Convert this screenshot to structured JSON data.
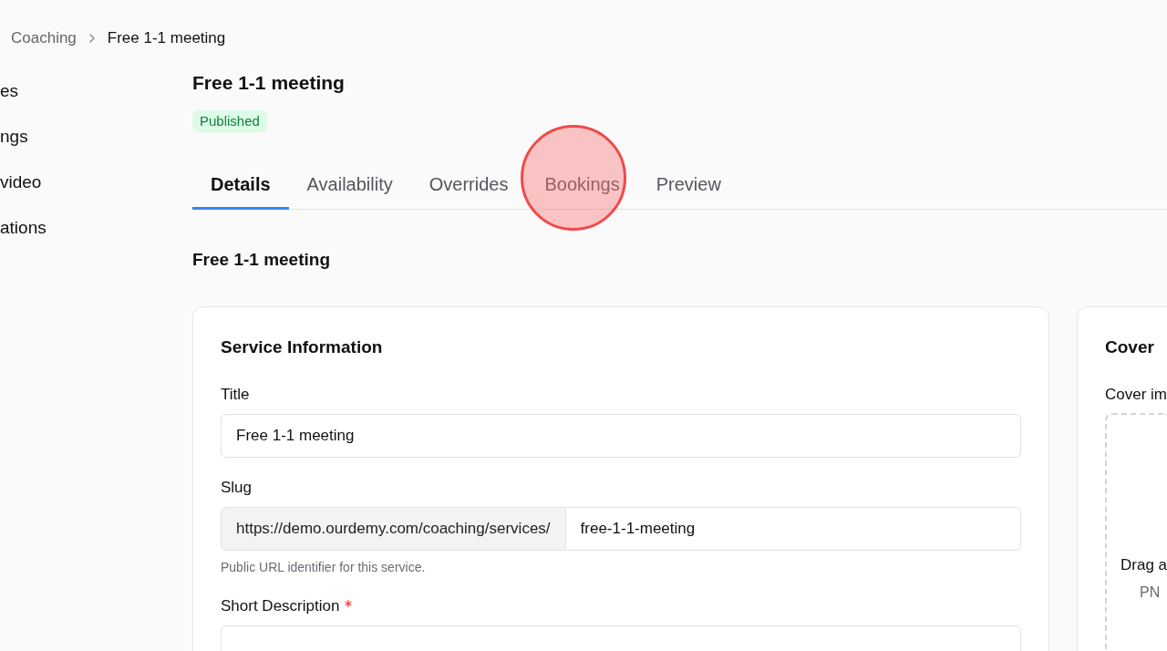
{
  "breadcrumb": [
    {
      "label": "Coaching",
      "current": false
    },
    {
      "label": "Free 1-1 meeting",
      "current": true
    }
  ],
  "sidebar": {
    "items": [
      "es",
      "ngs",
      "video",
      "ations"
    ]
  },
  "page": {
    "title": "Free 1-1 meeting",
    "status": "Published"
  },
  "tabs": [
    {
      "label": "Details",
      "selected": true,
      "highlighted": false
    },
    {
      "label": "Availability",
      "selected": false,
      "highlighted": false
    },
    {
      "label": "Overrides",
      "selected": false,
      "highlighted": false
    },
    {
      "label": "Bookings",
      "selected": false,
      "highlighted": true
    },
    {
      "label": "Preview",
      "selected": false,
      "highlighted": false
    }
  ],
  "section_title": "Free 1-1 meeting",
  "service_card": {
    "title": "Service Information",
    "fields": [
      {
        "kind": "text",
        "label": "Title",
        "required": false,
        "value": "Free 1-1 meeting"
      },
      {
        "kind": "prefixed",
        "label": "Slug",
        "required": false,
        "prefix": "https://demo.ourdemy.com/coaching/services/",
        "value": "free-1-1-meeting",
        "help": "Public URL identifier for this service."
      },
      {
        "kind": "text",
        "label": "Short Description",
        "required": true
      }
    ]
  },
  "cover_card": {
    "title": "Cover",
    "field_label": "Cover im",
    "dropzone": {
      "text": "Drag a",
      "hint": "PN"
    }
  }
}
